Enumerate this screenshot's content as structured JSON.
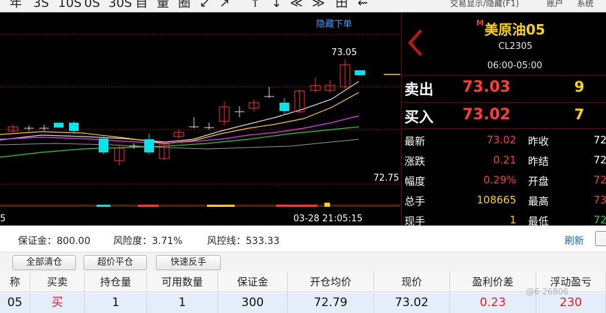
{
  "toolbar": {
    "items": [
      "年",
      "3S",
      "10S",
      "0S",
      "30S",
      "自",
      "量",
      "圈",
      "↙",
      "↗",
      "↑",
      "↓",
      "≪",
      "≫",
      "田",
      "⇜"
    ],
    "right_items": [
      "交易显示/隐藏(F1)",
      "账户",
      "系统"
    ]
  },
  "chart": {
    "hide_orders_label": "隐藏下单",
    "high_label": "73.05",
    "low_line_label": "72.75",
    "time_label": "03-28 21:05:15",
    "left_edge_label": "5",
    "colors": {
      "up": "#ff3333",
      "down": "#00e5ee",
      "ma_white": "#dddddd",
      "ma_yellow": "#ffd400",
      "ma_magenta": "#ff33ff",
      "ma_green": "#22dd22",
      "ma_gray": "#9a9a9a",
      "grid": "#aa1010",
      "bid_line": "#ffd400"
    }
  },
  "quote": {
    "badge": "M",
    "name": "美原油05",
    "code": "CL2305",
    "trade_time": "06:00-05:00",
    "ask_label": "卖出",
    "ask_price": "73.03",
    "ask_volume": "9",
    "bid_label": "买入",
    "bid_price": "73.02",
    "bid_volume": "7",
    "stats": [
      {
        "label": "最新",
        "value": "73.02",
        "label2": "昨收",
        "value2": "72"
      },
      {
        "label": "涨跌",
        "value": "0.21",
        "label2": "昨结",
        "value2": "72"
      },
      {
        "label": "幅度",
        "value": "0.29%",
        "label2": "开盘",
        "value2": "72"
      },
      {
        "label": "总手",
        "value": "108665",
        "label2": "最高",
        "value2": "73"
      },
      {
        "label": "现手",
        "value": "1",
        "label2": "最低",
        "value2": "72"
      }
    ]
  },
  "account": {
    "margin": "保证金：800.00",
    "risk": "风险度：3.71%",
    "risk_line": "风控线：533.33",
    "refresh": "刷新"
  },
  "actions": [
    "全部清仓",
    "超价平仓",
    "快速反手"
  ],
  "table": {
    "headers": [
      "称",
      "买卖",
      "持仓量",
      "可用数量",
      "保证金",
      "开仓均价",
      "现价",
      "盈利价差",
      "浮动盈亏"
    ],
    "row": [
      "05",
      "买",
      "1",
      "1",
      "300",
      "72.79",
      "73.02",
      "0.23",
      "230"
    ]
  },
  "watermark": "@6·26806"
}
